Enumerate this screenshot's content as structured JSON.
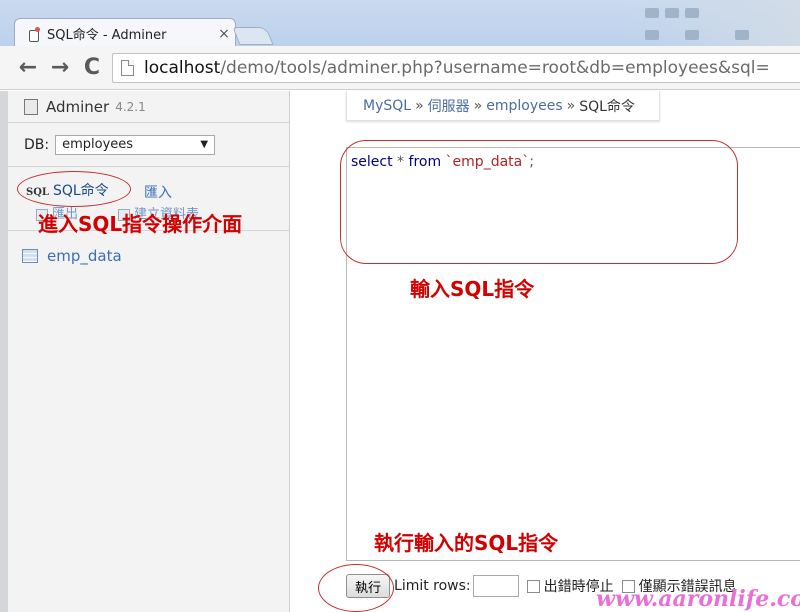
{
  "browser": {
    "tab_title": "SQL命令 - Adminer",
    "tab_close": "×",
    "url_host": "localhost",
    "url_path": "/demo/tools/adminer.php?username=root&db=employees&sql=",
    "nav_back": "←",
    "nav_forward": "→",
    "nav_reload": "C"
  },
  "sidebar": {
    "app_name": "Adminer",
    "app_version": "4.2.1",
    "db_label": "DB:",
    "db_value": "employees",
    "db_arrow": "▼",
    "sql_icon_text": "SQL",
    "sql_command": "SQL命令",
    "import": "匯入",
    "export": "匯出",
    "create_table": "建立資料表",
    "tables": [
      "emp_data"
    ]
  },
  "breadcrumb": {
    "items": [
      "MySQL",
      "伺服器",
      "employees"
    ],
    "separator": "»",
    "current": "SQL命令"
  },
  "editor": {
    "kw_select": "select",
    "star": " * ",
    "kw_from": "from",
    "table_literal": " `emp_data`",
    "terminator": ";"
  },
  "controls": {
    "execute": "執行",
    "limit_label": "Limit rows:",
    "limit_value": "",
    "stop_on_error": "出錯時停止",
    "only_errors": "僅顯示錯誤訊息"
  },
  "annotations": {
    "enter_sql_interface": "進入SQL指令操作介面",
    "input_sql": "輸入SQL指令",
    "execute_sql": "執行輸入的SQL指令",
    "color": "#d40000"
  },
  "watermark": "www.aaronlife.com"
}
